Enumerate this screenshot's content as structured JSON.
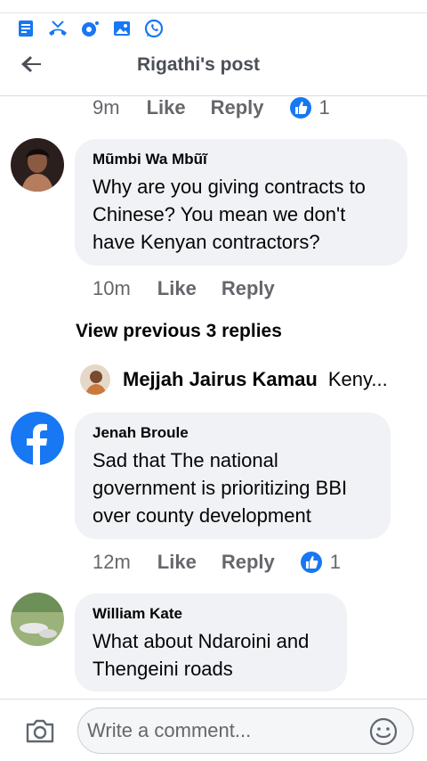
{
  "header": {
    "title": "Rigathi's post"
  },
  "status_icons": [
    "notes-icon",
    "missed-call-icon",
    "podcast-icon",
    "gallery-icon",
    "whatsapp-icon"
  ],
  "colors": {
    "like_blue": "#1877f2",
    "bubble_bg": "#f0f2f5",
    "meta_gray": "#65676b"
  },
  "top_meta": {
    "time": "9m",
    "like": "Like",
    "reply": "Reply",
    "reaction_count": "1"
  },
  "comments": [
    {
      "author": "Mũmbi Wa Mbũĩ",
      "text_lines": [
        "Why are you giving contracts to",
        "Chinese? You mean we don't",
        "have Kenyan contractors?"
      ],
      "time": "10m",
      "like": "Like",
      "reply": "Reply"
    },
    {
      "author": "Jenah Broule",
      "text_lines": [
        "Sad that The national",
        "government is prioritizing BBI",
        "over county development"
      ],
      "time": "12m",
      "like": "Like",
      "reply": "Reply",
      "reaction_count": "1"
    },
    {
      "author": "William Kate",
      "text_lines": [
        "What about Ndaroini and",
        "Thengeini roads"
      ]
    }
  ],
  "view_previous": "View previous 3 replies",
  "reply_preview": {
    "author": "Mejjah Jairus Kamau",
    "text": "Keny..."
  },
  "composer": {
    "placeholder": "Write a comment..."
  }
}
